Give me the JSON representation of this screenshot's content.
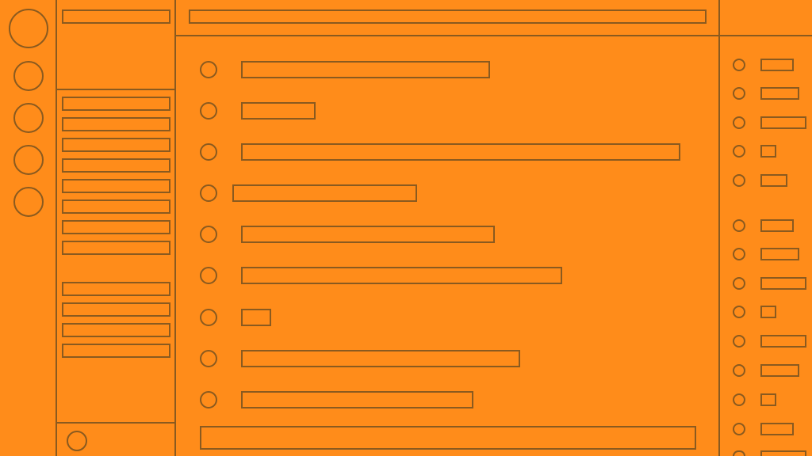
{
  "theme": {
    "background": "#ff8c1a",
    "stroke": "#8a5a1f"
  },
  "server_rail": {
    "items": [
      "server-1",
      "server-2",
      "server-3",
      "server-4",
      "server-5"
    ]
  },
  "channel_sidebar": {
    "header": "",
    "group_a": [
      "",
      "",
      "",
      "",
      "",
      "",
      "",
      ""
    ],
    "group_b": [
      "",
      "",
      "",
      ""
    ],
    "user_panel": {
      "avatar_icon": "avatar-icon"
    }
  },
  "topbar": {
    "title": ""
  },
  "messages": [
    "",
    "",
    "",
    "",
    "",
    "",
    "",
    "",
    ""
  ],
  "composer": {
    "placeholder": ""
  },
  "members": {
    "group_a": [
      "",
      "",
      "",
      "",
      ""
    ],
    "group_b": [
      "",
      "",
      "",
      "",
      "",
      "",
      "",
      ""
    ]
  }
}
